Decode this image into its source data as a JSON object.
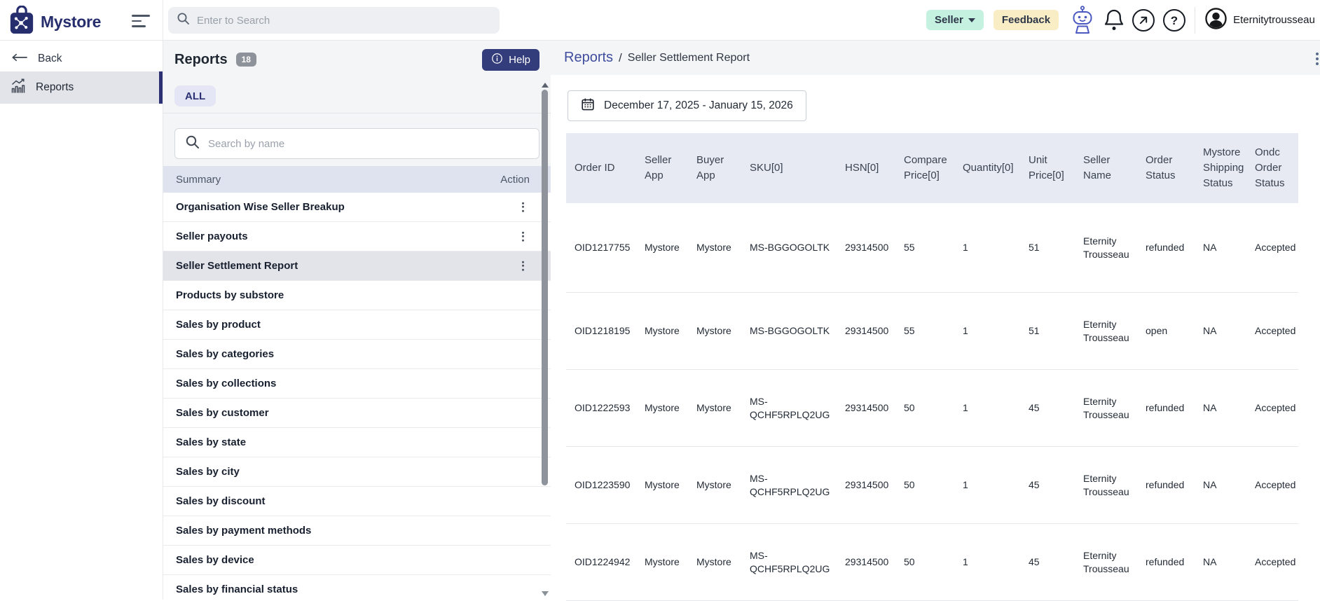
{
  "navbar": {
    "brand": "Mystore",
    "search_placeholder": "Enter to Search",
    "seller_label": "Seller",
    "feedback_label": "Feedback",
    "username": "Eternitytrousseau"
  },
  "sidebar": {
    "back_label": "Back",
    "reports_label": "Reports"
  },
  "panel": {
    "title": "Reports",
    "count_badge": "18",
    "help_label": "Help",
    "tab_all_label": "ALL",
    "search_placeholder": "Search by name",
    "list_header": {
      "summary": "Summary",
      "action": "Action"
    },
    "items": [
      {
        "label": "Organisation Wise Seller Breakup",
        "has_action": true
      },
      {
        "label": "Seller payouts",
        "has_action": true
      },
      {
        "label": "Seller Settlement Report",
        "has_action": true,
        "selected": true
      },
      {
        "label": "Products by substore"
      },
      {
        "label": "Sales by product"
      },
      {
        "label": "Sales by categories"
      },
      {
        "label": "Sales by collections"
      },
      {
        "label": "Sales by customer"
      },
      {
        "label": "Sales by state"
      },
      {
        "label": "Sales by city"
      },
      {
        "label": "Sales by discount"
      },
      {
        "label": "Sales by payment methods"
      },
      {
        "label": "Sales by device"
      },
      {
        "label": "Sales by financial status"
      }
    ]
  },
  "main": {
    "breadcrumb": {
      "parent": "Reports",
      "separator": "/",
      "current": "Seller Settlement Report"
    },
    "date_range": "December 17, 2025 - January 15, 2026",
    "table": {
      "columns": [
        "Order ID",
        "Seller App",
        "Buyer App",
        "SKU[0]",
        "HSN[0]",
        "Compare Price[0]",
        "Quantity[0]",
        "Unit Price[0]",
        "Seller Name",
        "Order Status",
        "Mystore Shipping Status",
        "Ondc Order Status"
      ],
      "rows": [
        [
          "OID1217755",
          "Mystore",
          "Mystore",
          "MS-BGGOGOLTK",
          "29314500",
          "55",
          "1",
          "51",
          "Eternity Trousseau",
          "refunded",
          "NA",
          "Accepted"
        ],
        [
          "OID1218195",
          "Mystore",
          "Mystore",
          "MS-BGGOGOLTK",
          "29314500",
          "55",
          "1",
          "51",
          "Eternity Trousseau",
          "open",
          "NA",
          "Accepted"
        ],
        [
          "OID1222593",
          "Mystore",
          "Mystore",
          "MS-QCHF5RPLQ2UG",
          "29314500",
          "50",
          "1",
          "45",
          "Eternity Trousseau",
          "refunded",
          "NA",
          "Accepted"
        ],
        [
          "OID1223590",
          "Mystore",
          "Mystore",
          "MS-QCHF5RPLQ2UG",
          "29314500",
          "50",
          "1",
          "45",
          "Eternity Trousseau",
          "refunded",
          "NA",
          "Accepted"
        ],
        [
          "OID1224942",
          "Mystore",
          "Mystore",
          "MS-QCHF5RPLQ2UG",
          "29314500",
          "50",
          "1",
          "45",
          "Eternity Trousseau",
          "refunded",
          "NA",
          "Accepted"
        ]
      ]
    }
  },
  "colors": {
    "brand_navy": "#272e6e",
    "accent_navy": "#333d7c",
    "sidebar_accent": "#2b3173",
    "seller_chip_bg": "#c5f1e0",
    "feedback_chip_bg": "#f9edc5",
    "breadcrumb_link": "#3f4d9e",
    "table_header_bg": "#e7eaf3",
    "list_header_bg": "#dee3ef",
    "robot_icon": "#4a58c0"
  }
}
